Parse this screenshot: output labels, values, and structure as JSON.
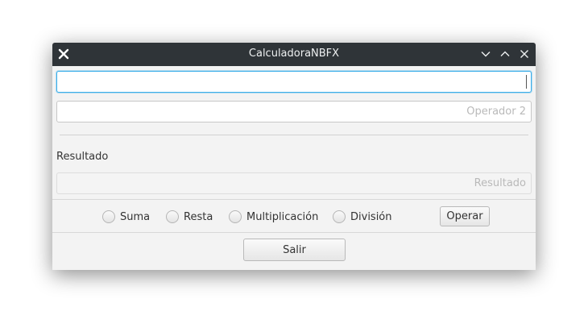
{
  "window": {
    "title": "CalculadoraNBFX",
    "icons": {
      "app": "close-x-icon",
      "minimize": "chevron-down-icon",
      "maximize": "chevron-up-icon",
      "close": "close-icon"
    }
  },
  "fields": {
    "operator1": {
      "value": "",
      "placeholder": ""
    },
    "operator2": {
      "value": "",
      "placeholder": "Operador 2"
    },
    "result": {
      "value": "",
      "placeholder": "Resultado"
    }
  },
  "result_label": "Resultado",
  "operations": [
    {
      "label": "Suma",
      "selected": false
    },
    {
      "label": "Resta",
      "selected": false
    },
    {
      "label": "Multiplicación",
      "selected": false
    },
    {
      "label": "División",
      "selected": false
    }
  ],
  "buttons": {
    "operate": "Operar",
    "exit": "Salir"
  },
  "colors": {
    "titlebar": "#2f3438",
    "focus": "#3daee9",
    "window_bg": "#f3f3f3"
  }
}
